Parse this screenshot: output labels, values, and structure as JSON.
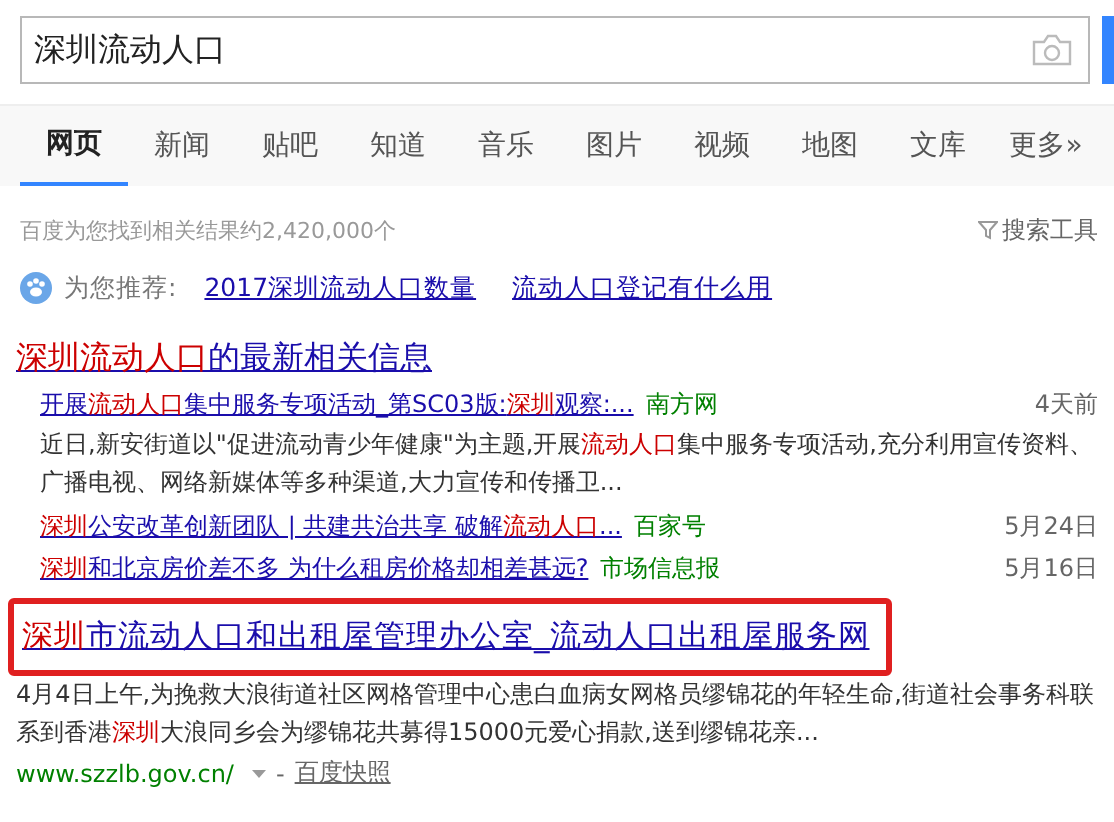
{
  "search": {
    "value": "深圳流动人口"
  },
  "tabs": [
    {
      "label": "网页",
      "selected": true
    },
    {
      "label": "新闻",
      "selected": false
    },
    {
      "label": "贴吧",
      "selected": false
    },
    {
      "label": "知道",
      "selected": false
    },
    {
      "label": "音乐",
      "selected": false
    },
    {
      "label": "图片",
      "selected": false
    },
    {
      "label": "视频",
      "selected": false
    },
    {
      "label": "地图",
      "selected": false
    },
    {
      "label": "文库",
      "selected": false
    },
    {
      "label": "更多»",
      "selected": false
    }
  ],
  "result_count": "百度为您找到相关结果约2,420,000个",
  "search_tools": "搜索工具",
  "recommend": {
    "label": "为您推荐:",
    "links": [
      "2017深圳流动人口数量",
      "流动人口登记有什么用"
    ]
  },
  "news_block": {
    "title": [
      {
        "text": "深圳流动人口",
        "highlight": true
      },
      {
        "text": "的最新相关信息",
        "highlight": false
      }
    ],
    "items": [
      {
        "title": [
          {
            "text": "开展",
            "highlight": false
          },
          {
            "text": "流动人口",
            "highlight": true
          },
          {
            "text": "集中服务专项活动_第SC03版:",
            "highlight": false
          },
          {
            "text": "深圳",
            "highlight": true
          },
          {
            "text": "观察:...",
            "highlight": false
          }
        ],
        "source": "南方网",
        "time": "4天前",
        "snippet": [
          {
            "text": "近日,新安街道以\"促进流动青少年健康\"为主题,开展",
            "highlight": false
          },
          {
            "text": "流动人口",
            "highlight": true
          },
          {
            "text": "集中服务专项活动,充分利用宣传资料、广播电视、网络新媒体等多种渠道,大力宣传和传播卫...",
            "highlight": false
          }
        ]
      },
      {
        "title": [
          {
            "text": "深圳",
            "highlight": true
          },
          {
            "text": "公安改革创新团队 | 共建共治共享 破解",
            "highlight": false
          },
          {
            "text": "流动人口",
            "highlight": true
          },
          {
            "text": "...",
            "highlight": false
          }
        ],
        "source": "百家号",
        "time": "5月24日"
      },
      {
        "title": [
          {
            "text": "深圳",
            "highlight": true
          },
          {
            "text": "和北京房价差不多 为什么租房价格却相差甚远?",
            "highlight": false
          }
        ],
        "source": "市场信息报",
        "time": "5月16日"
      }
    ]
  },
  "result": {
    "boxed": true,
    "title": [
      {
        "text": "深圳",
        "highlight": true
      },
      {
        "text": "市流动人口和出租屋管理办公室_流动人口出租屋服务网",
        "highlight": false
      }
    ],
    "snippet": [
      {
        "text": "4月4日上午,为挽救大浪街道社区网格管理中心患白血病女网格员缪锦花的年轻生命,街道社会事务科联系到香港",
        "highlight": false
      },
      {
        "text": "深圳",
        "highlight": true
      },
      {
        "text": "大浪同乡会为缪锦花共募得15000元爱心捐款,送到缪锦花亲...",
        "highlight": false
      }
    ],
    "url": "www.szzlb.gov.cn/",
    "separator": "-",
    "cache": "百度快照"
  }
}
